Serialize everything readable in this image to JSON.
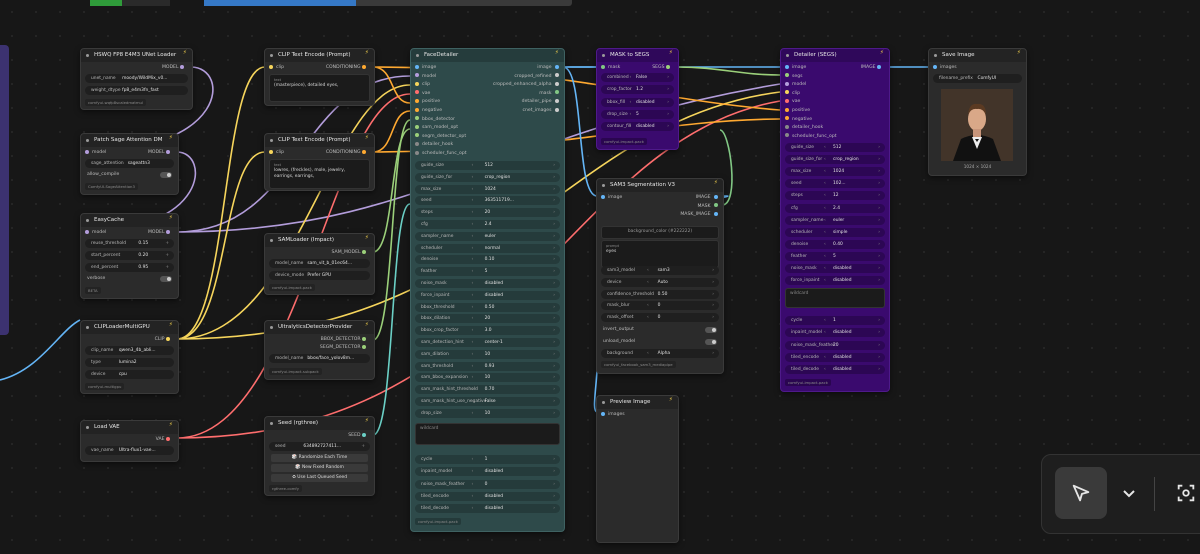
{
  "nodes": {
    "unet": {
      "title": "HSWQ FP8 E4M3 UNet Loader",
      "out": "MODEL",
      "unet_name_lbl": "unet_name",
      "unet_name": "moody/WildMix_v0...",
      "dtype_lbl": "weight_dtype",
      "dtype": "fp8_e4m3fn_fast",
      "tag": "comfyui-wqfp8scaledmatmul"
    },
    "patch": {
      "title": "Patch Sage Attention DM",
      "in": "model",
      "out": "MODEL",
      "attn_lbl": "sage_attention",
      "attn": "sageattn3",
      "compile_lbl": "allow_compile",
      "tag": "ComfyUI-SageAttention3"
    },
    "easycache": {
      "title": "EasyCache",
      "in": "model",
      "out": "MODEL",
      "r1": "reuse_threshold",
      "v1": "0.15",
      "r2": "start_percent",
      "v2": "0.20",
      "r3": "end_percent",
      "v3": "0.95",
      "r4": "verbose",
      "tag": "BETA"
    },
    "clipmulti": {
      "title": "CLIPLoaderMultiGPU",
      "out": "CLIP",
      "clip_lbl": "clip_name",
      "clip": "qwen3_4b_abli...",
      "type_lbl": "type",
      "type": "lumina2",
      "dev_lbl": "device",
      "dev": "cpu",
      "tag": "comfyui-multigpu"
    },
    "vae": {
      "title": "Load VAE",
      "out": "VAE",
      "name_lbl": "vae_name",
      "name": "Ultra-flux1-vae..."
    },
    "clip1": {
      "title": "CLIP Text Encode (Prompt)",
      "in": "clip",
      "out": "CONDITIONING",
      "text_lbl": "text",
      "text": "(masterpiece), detailed eyes,"
    },
    "clip2": {
      "title": "CLIP Text Encode (Prompt)",
      "in": "clip",
      "out": "CONDITIONING",
      "text_lbl": "text",
      "text": "lowres, (freckles), mole, jewelry, earrings, earrings,"
    },
    "samloader": {
      "title": "SAMLoader (Impact)",
      "out": "SAM_MODEL",
      "m_lbl": "model_name",
      "m": "sam_vit_b_01ec64...",
      "d_lbl": "device_mode",
      "d": "Prefer GPU",
      "tag": "comfyui-impact-pack"
    },
    "ultra": {
      "title": "UltralyticsDetectorProvider",
      "o1": "BBOX_DETECTOR",
      "o2": "SEGM_DETECTOR",
      "m_lbl": "model_name",
      "m": "bbox/face_yolov8m...",
      "tag": "comfyui-impact-subpack"
    },
    "seed": {
      "title": "Seed (rgthree)",
      "out": "SEED",
      "seed_lbl": "seed",
      "seed": "634892727411...",
      "b1": "Randomize Each Time",
      "b2": "New Fixed Random",
      "b3": "Use Last Queued Seed",
      "tag": "rgthree-comfy"
    },
    "face": {
      "title": "FaceDetailer",
      "inputs": [
        "image",
        "model",
        "clip",
        "vae",
        "positive",
        "negative",
        "bbox_detector",
        "sam_model_opt",
        "segm_detector_opt",
        "detailer_hook",
        "scheduler_func_opt"
      ],
      "outputs": [
        "image",
        "cropped_refined",
        "cropped_enhanced_alpha",
        "mask",
        "detailer_pipe",
        "cnet_images"
      ],
      "widgets": [
        [
          "guide_size",
          "512"
        ],
        [
          "guide_size_for",
          "crop_region"
        ],
        [
          "max_size",
          "1024"
        ],
        [
          "seed",
          "363511719..."
        ],
        [
          "steps",
          "20"
        ],
        [
          "cfg",
          "2.4"
        ],
        [
          "sampler_name",
          "euler"
        ],
        [
          "scheduler",
          "normal"
        ],
        [
          "denoise",
          "0.10"
        ],
        [
          "feather",
          "5"
        ],
        [
          "noise_mask",
          "disabled"
        ],
        [
          "force_inpaint",
          "disabled"
        ],
        [
          "bbox_threshold",
          "0.50"
        ],
        [
          "bbox_dilation",
          "20"
        ],
        [
          "bbox_crop_factor",
          "3.0"
        ],
        [
          "sam_detection_hint",
          "center-1"
        ],
        [
          "sam_dilation",
          "10"
        ],
        [
          "sam_threshold",
          "0.93"
        ],
        [
          "sam_bbox_expansion",
          "10"
        ],
        [
          "sam_mask_hint_threshold",
          "0.70"
        ],
        [
          "sam_mask_hint_use_negative",
          "False"
        ],
        [
          "drop_size",
          "10"
        ]
      ],
      "wildcard": "wildcard",
      "widgets2": [
        [
          "cycle",
          "1"
        ],
        [
          "inpaint_model",
          "disabled"
        ],
        [
          "noise_mask_feather",
          "0"
        ],
        [
          "tiled_encode",
          "disabled"
        ],
        [
          "tiled_decode",
          "disabled"
        ]
      ],
      "tag": "comfyui-impact-pack"
    },
    "mask2segs": {
      "title": "MASK to SEGS",
      "in": "mask",
      "out": "SEGS",
      "w": [
        [
          "combined",
          "False"
        ],
        [
          "crop_factor",
          "1.2"
        ],
        [
          "bbox_fill",
          "disabled"
        ],
        [
          "drop_size",
          "5"
        ],
        [
          "contour_fill",
          "disabled"
        ]
      ],
      "tag": "comfyui-impact-pack"
    },
    "sam3": {
      "title": "SAM3 Segmentation V3",
      "in": "image",
      "outs": [
        "IMAGE",
        "MASK",
        "MASK_IMAGE"
      ],
      "box1": "background_color (#222222)",
      "prompt_lbl": "prompt",
      "prompt": "eyes",
      "w": [
        [
          "sam3_model",
          "sam3"
        ],
        [
          "device",
          "Auto"
        ],
        [
          "confidence_threshold",
          "0.50"
        ],
        [
          "mask_blur",
          "0"
        ],
        [
          "mask_offset",
          "0"
        ],
        [
          "invert_output",
          ""
        ],
        [
          "unload_model",
          ""
        ],
        [
          "background",
          "Alpha"
        ]
      ],
      "tag": "comfyui_facebook_sam3_mediapipe"
    },
    "preview": {
      "title": "Preview Image",
      "in": "images"
    },
    "detailer": {
      "title": "Detailer (SEGS)",
      "inputs": [
        "image",
        "segs",
        "model",
        "clip",
        "vae",
        "positive",
        "negative",
        "detailer_hook",
        "scheduler_func_opt"
      ],
      "out": "IMAGE",
      "w": [
        [
          "guide_size",
          "512"
        ],
        [
          "guide_size_for",
          "crop_region"
        ],
        [
          "max_size",
          "1024"
        ],
        [
          "seed",
          "102..."
        ],
        [
          "steps",
          "12"
        ],
        [
          "cfg",
          "2.4"
        ],
        [
          "sampler_name",
          "euler"
        ],
        [
          "scheduler",
          "simple"
        ],
        [
          "denoise",
          "0.40"
        ],
        [
          "feather",
          "5"
        ],
        [
          "noise_mask",
          "disabled"
        ],
        [
          "force_inpaint",
          "disabled"
        ]
      ],
      "wildcard": "wildcard",
      "w2": [
        [
          "cycle",
          "1"
        ],
        [
          "inpaint_model",
          "disabled"
        ],
        [
          "noise_mask_feather",
          "20"
        ],
        [
          "tiled_encode",
          "disabled"
        ],
        [
          "tiled_decode",
          "disabled"
        ]
      ],
      "tag": "comfyui-impact-pack"
    },
    "save": {
      "title": "Save Image",
      "in": "images",
      "prefix_lbl": "filename_prefix",
      "prefix": "ComfyUI",
      "caption": "1024 × 1024"
    }
  },
  "toolbar": {
    "select": "pointer-icon",
    "chevron": "chevron-down-icon",
    "fit": "fit-view-icon"
  },
  "colors": {
    "model": "#b39ddb",
    "clip": "#f6d55c",
    "vae": "#ff6e6e",
    "image": "#64b5f6",
    "conditioning": "#ffa931",
    "mask": "#81c784",
    "teal": "#2e4a4a",
    "purple": "#3a0a6e"
  }
}
